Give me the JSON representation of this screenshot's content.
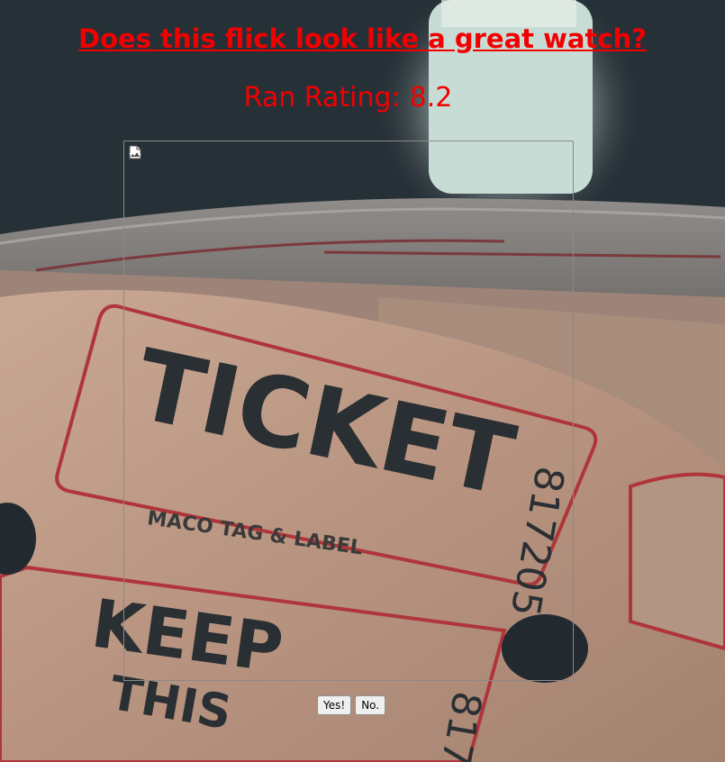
{
  "page": {
    "question": "Does this flick look like a great watch?",
    "rating_label": "Ran Rating:",
    "rating_value": "8.2",
    "accent_color": "#f20000"
  },
  "poster": {
    "icon": "broken-image-icon"
  },
  "buttons": {
    "yes_label": "Yes!",
    "no_label": "No."
  },
  "background": {
    "ticket_front_text": "TICKET",
    "ticket_number": "817205",
    "ticket_brand": "MACO TAG & LABEL",
    "ticket_lower_text": "KEEP",
    "ticket_lower_text2": "THIS",
    "ticket_lower_number": "817"
  }
}
